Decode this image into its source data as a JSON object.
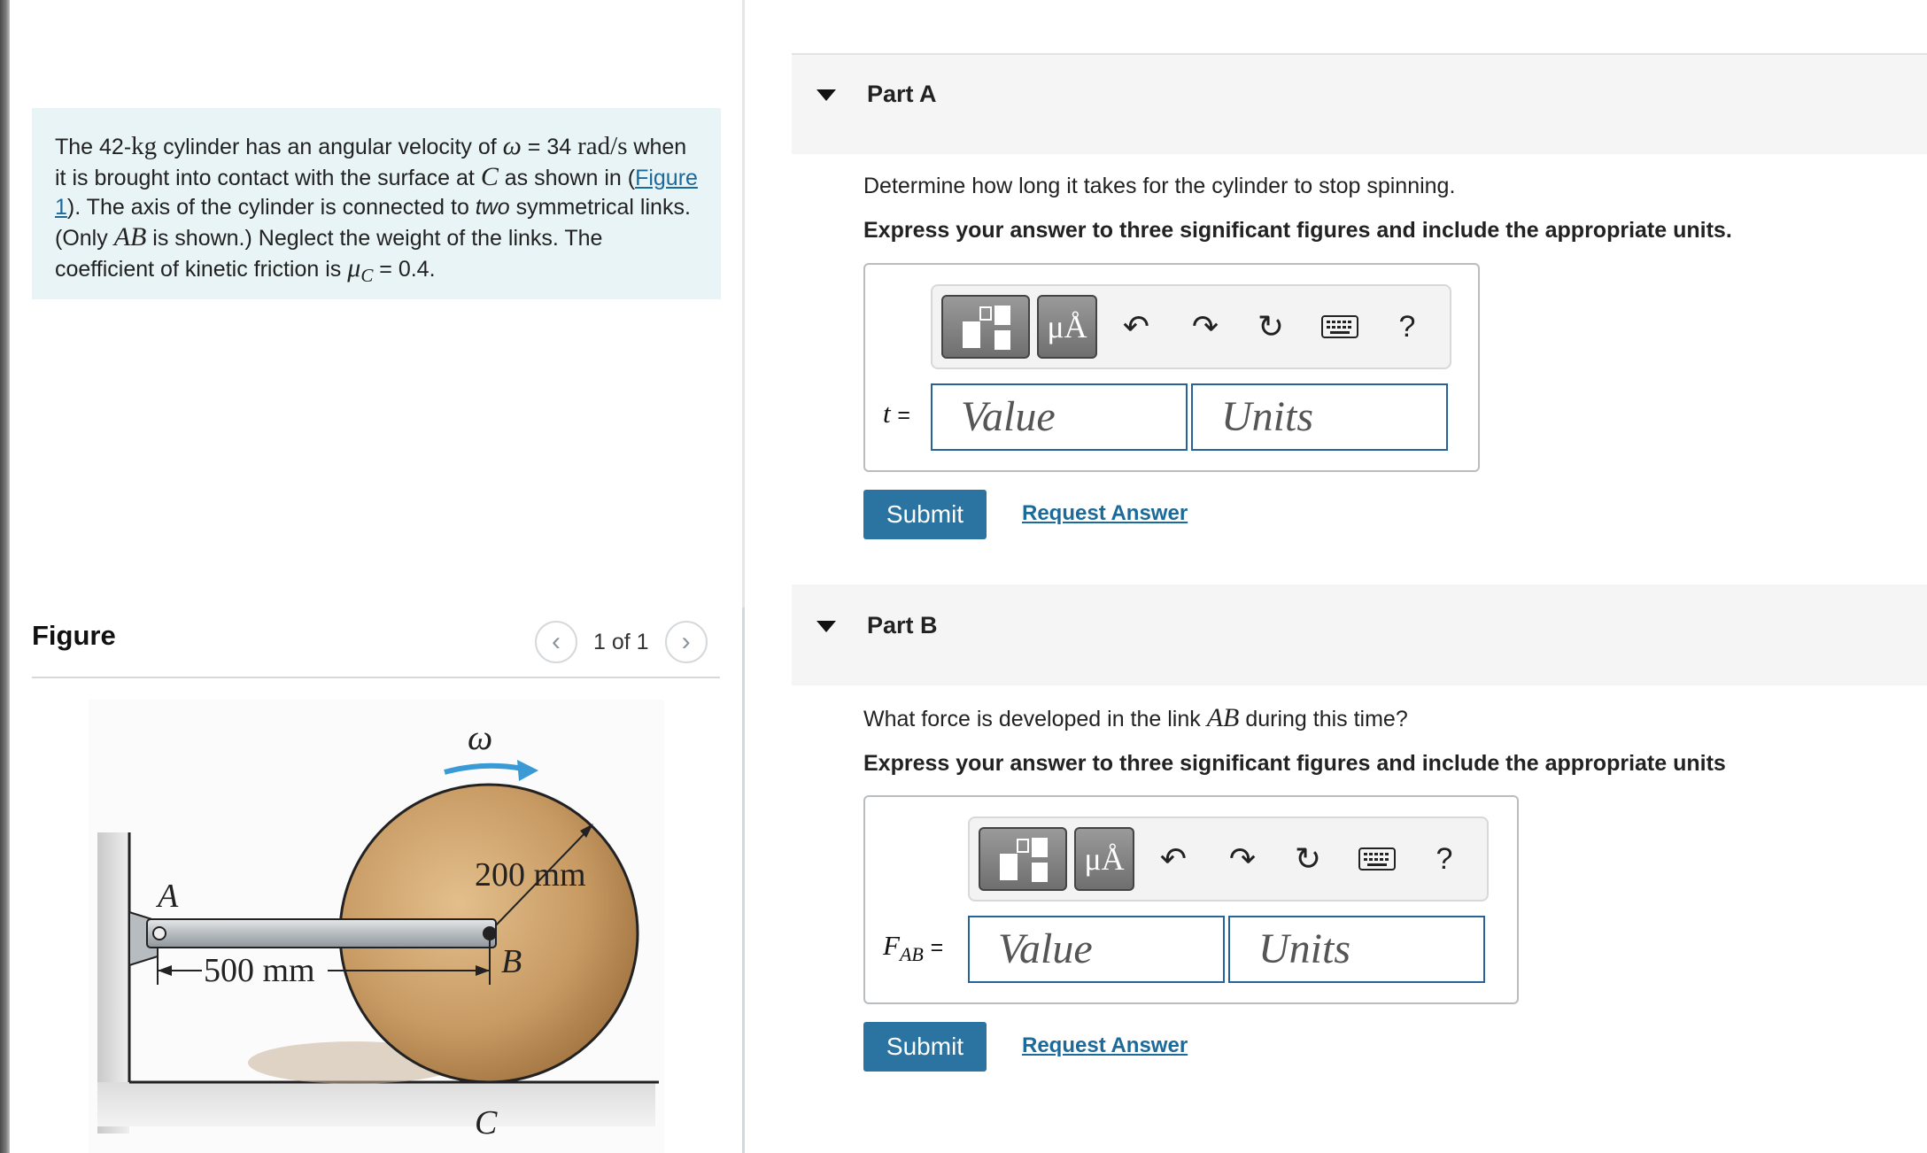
{
  "problem": {
    "text_1": "The 42-",
    "kg": "kg",
    "text_2": " cylinder has an angular velocity of ",
    "omega": "ω",
    "text_3": " = 34 ",
    "rad_s": "rad/s",
    "text_4": " when it is brought into contact with the surface at ",
    "C": "C",
    "text_5": " as shown in (",
    "figure_link": "Figure 1",
    "text_6": "). The axis of the cylinder is connected to ",
    "two": "two",
    "text_7": " symmetrical links. (Only ",
    "AB": "AB",
    "text_8": " is shown.) Neglect the weight of the links. The coefficient of kinetic friction is ",
    "mu": "μ",
    "mu_sub": "C",
    "text_9": " = 0.4."
  },
  "figure": {
    "title": "Figure",
    "count": "1 of 1",
    "prev_icon": "chevron-left-icon",
    "next_icon": "chevron-right-icon",
    "labels": {
      "omega": "ω",
      "A": "A",
      "B": "B",
      "C": "C",
      "radius": "200 mm",
      "length": "500 mm"
    }
  },
  "parts": [
    {
      "title": "Part A",
      "question_1": "Determine how long it takes for the cylinder to stop spinning.",
      "instruction": "Express your answer to three significant figures and include the appropriate units.",
      "variable": "t",
      "variable_sub": "",
      "equals": "=",
      "value_placeholder": "Value",
      "units_placeholder": "Units",
      "submit": "Submit",
      "request": "Request Answer"
    },
    {
      "title": "Part B",
      "question_1": "What force is developed in the link ",
      "question_math": "AB",
      "question_2": " during this time?",
      "instruction": "Express your answer to three significant figures and include the appropriate units",
      "variable": "F",
      "variable_sub": "AB",
      "equals": "=",
      "value_placeholder": "Value",
      "units_placeholder": "Units",
      "submit": "Submit",
      "request": "Request Answer"
    }
  ],
  "toolbar": {
    "templates_icon": "templates-icon",
    "units_label": "μÅ",
    "undo_icon": "undo-icon",
    "redo_icon": "redo-icon",
    "reset_icon": "reset-icon",
    "keyboard_icon": "keyboard-icon",
    "help_label": "?"
  },
  "colors": {
    "problem_bg": "#e9f4f7",
    "link": "#1b6a9a",
    "submit_bg": "#2b74a1",
    "field_border": "#27639b",
    "part_header_bg": "#f5f5f5",
    "cylinder": "#c89a63",
    "omega_arrow": "#3a9ad6"
  }
}
